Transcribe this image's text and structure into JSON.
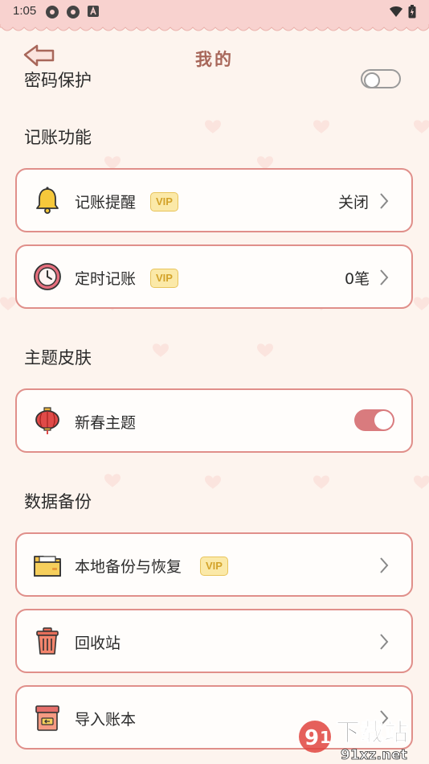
{
  "status": {
    "time": "1:05"
  },
  "header": {
    "title": "我的"
  },
  "password_row": {
    "label": "密码保护",
    "enabled": false
  },
  "sections": {
    "accounting": "记账功能",
    "theme": "主题皮肤",
    "backup": "数据备份"
  },
  "items": {
    "reminder": {
      "label": "记账提醒",
      "badge": "VIP",
      "value": "关闭"
    },
    "scheduled": {
      "label": "定时记账",
      "badge": "VIP",
      "value": "0笔"
    },
    "spring_theme": {
      "label": "新春主题",
      "enabled": true
    },
    "local_backup": {
      "label": "本地备份与恢复",
      "badge": "VIP"
    },
    "recycle": {
      "label": "回收站"
    },
    "import": {
      "label": "导入账本"
    }
  },
  "watermark": {
    "brand": "下载站",
    "domain": "91xz.net"
  },
  "colors": {
    "background": "#fdf4ee",
    "card_border": "#e08f8a",
    "accent": "#d97b7e",
    "title": "#a8675a",
    "vip_bg": "#fbe9a8"
  }
}
